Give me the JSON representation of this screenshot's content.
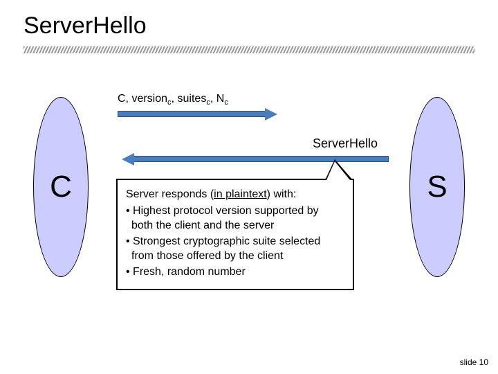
{
  "title": "ServerHello",
  "client_label": "C",
  "server_label": "S",
  "arrow1_label_html": "C, version<sub>c</sub>, suites<sub>c</sub>, N<sub>c</sub>",
  "serverhello_label": "ServerHello",
  "callout": {
    "lead_pre": "Server responds (",
    "lead_u": "in plaintext",
    "lead_post": ") with:",
    "b1a": "Highest protocol version supported by",
    "b1b": "both the client and the server",
    "b2a": "Strongest cryptographic suite selected",
    "b2b": "from those offered by the client",
    "b3": "Fresh, random number"
  },
  "slide_number": "slide 10",
  "colors": {
    "party_fill": "#ccccff",
    "arrow": "#4a7dbb"
  }
}
